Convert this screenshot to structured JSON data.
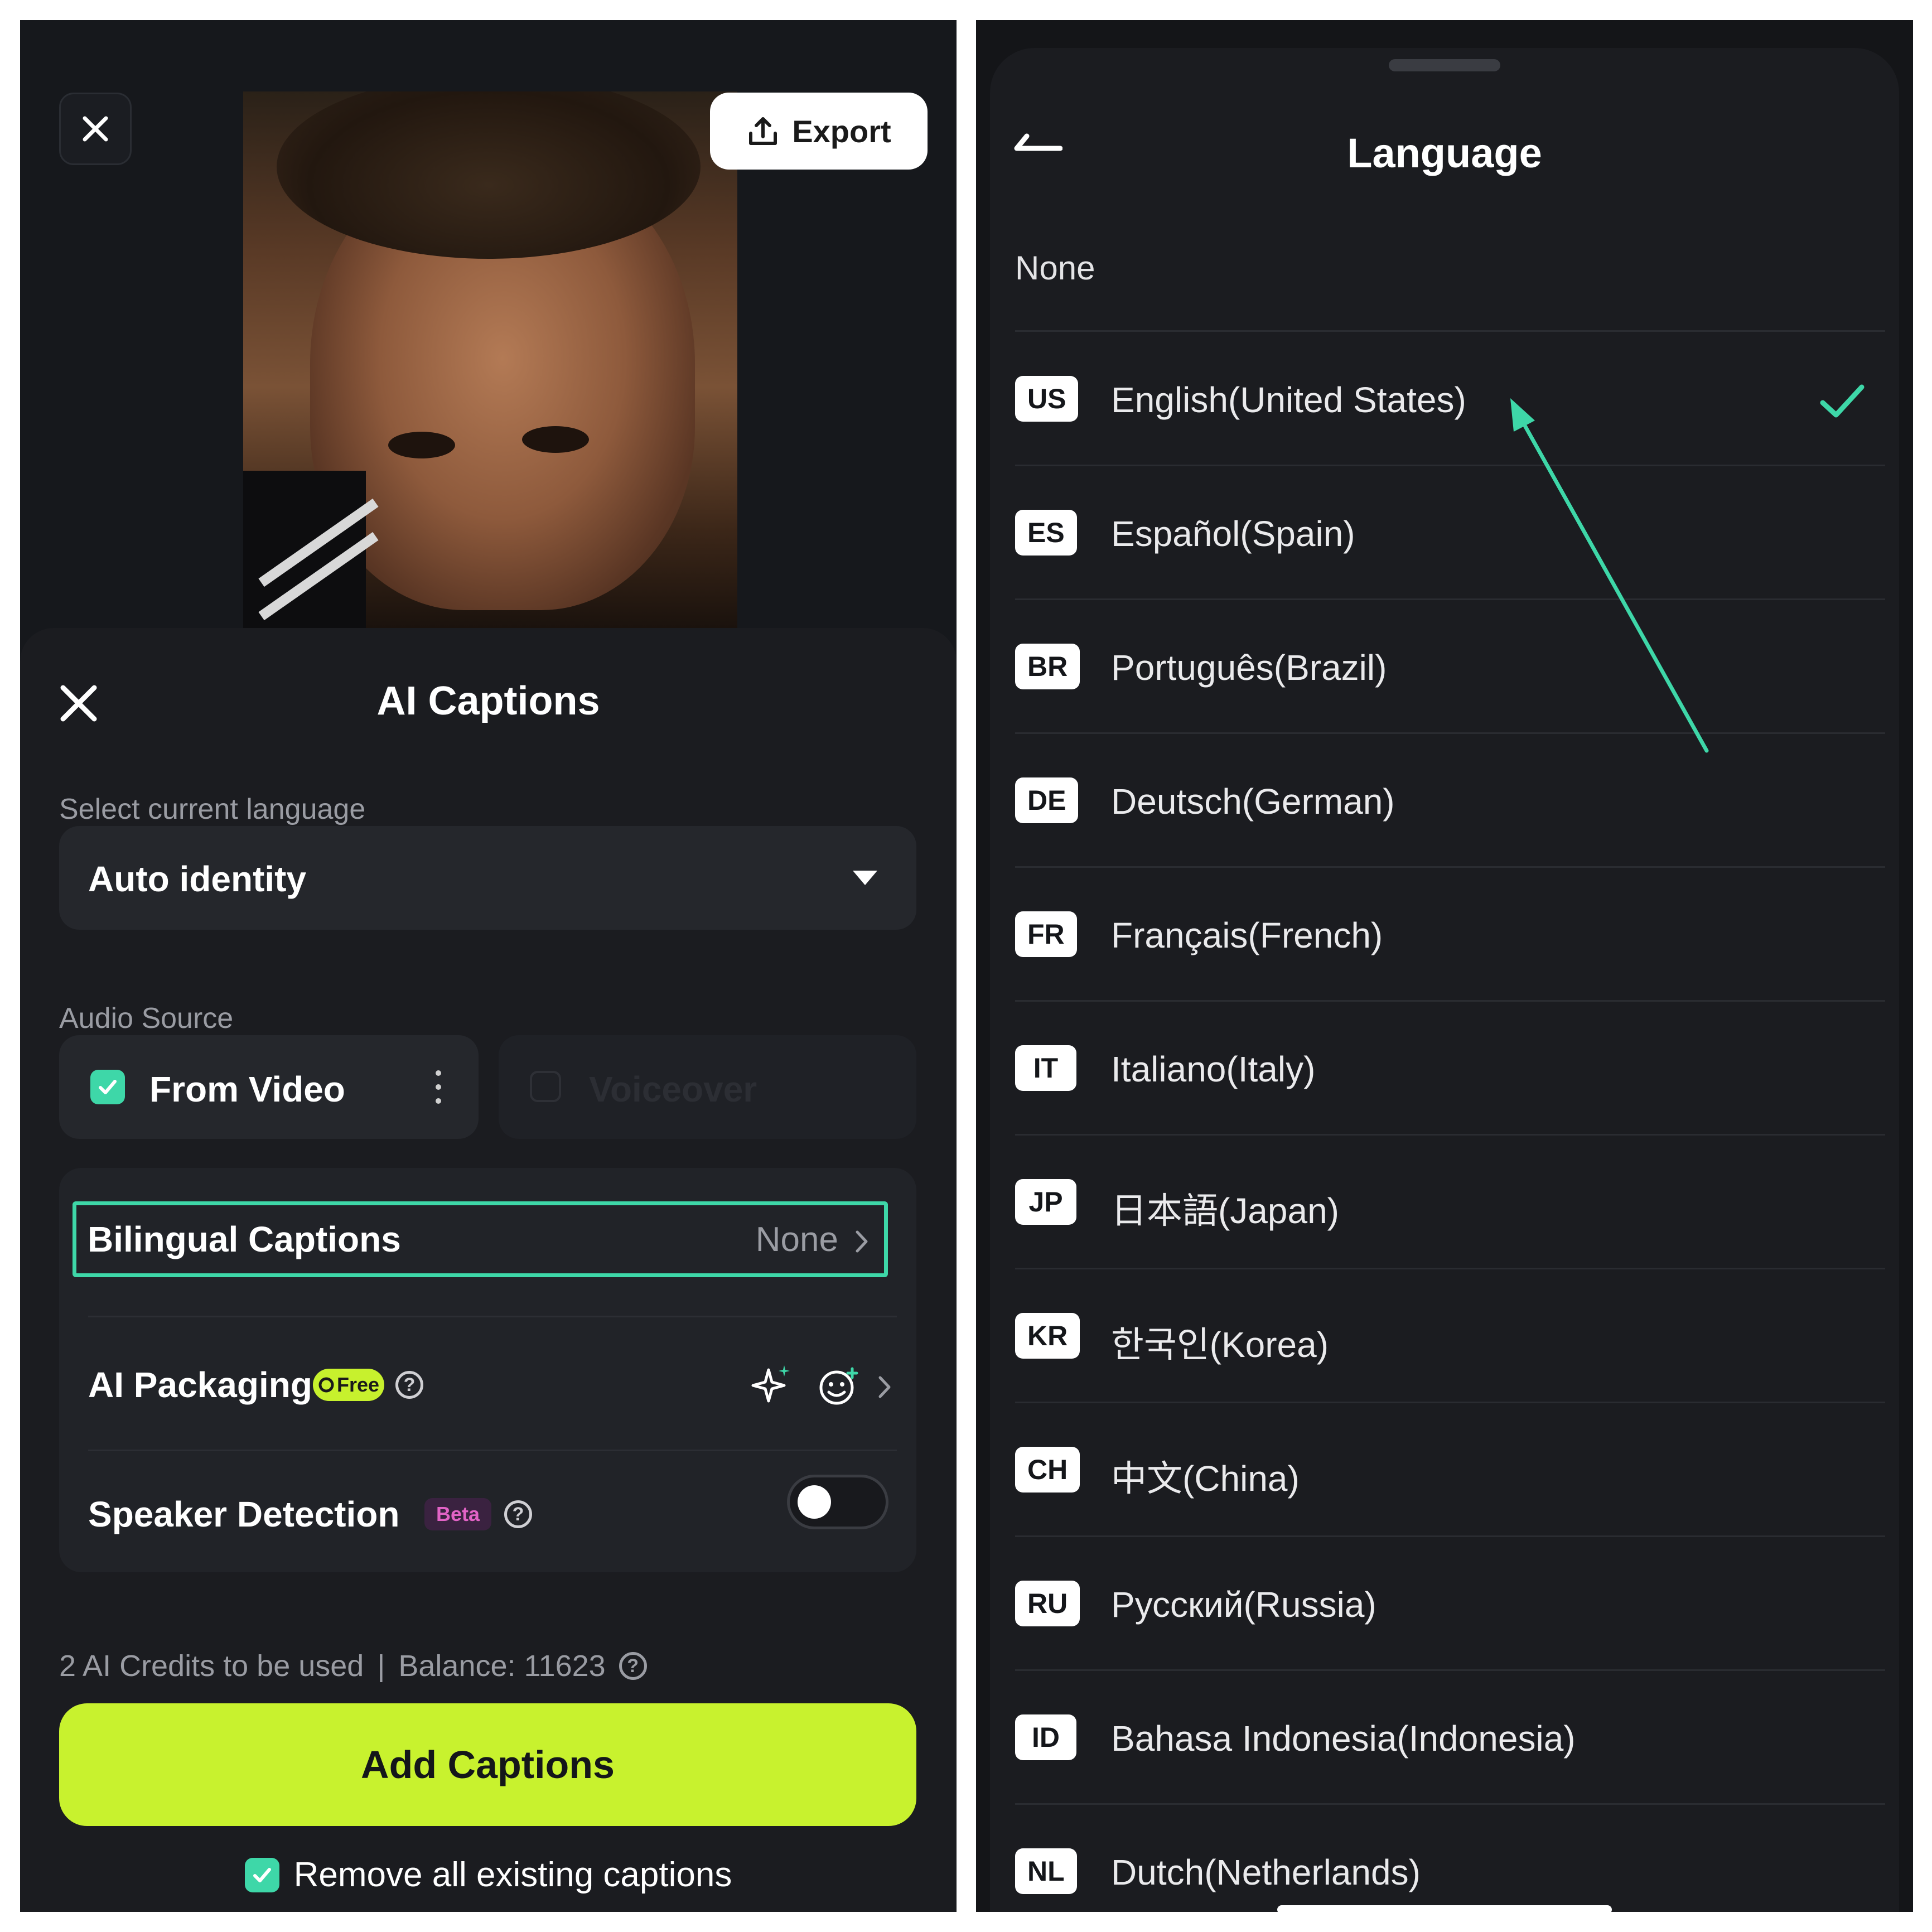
{
  "left": {
    "export_label": "Export",
    "title": "AI Captions",
    "select_language_label": "Select current language",
    "language_value": "Auto identity",
    "audio_source_label": "Audio Source",
    "from_video_label": "From Video",
    "voiceover_label": "Voiceover",
    "bilingual_label": "Bilingual Captions",
    "bilingual_value": "None",
    "packaging_label": "AI Packaging",
    "free_badge": "Free",
    "speaker_label": "Speaker Detection",
    "beta_badge": "Beta",
    "speaker_detection_on": false,
    "credits_text": "2 AI Credits to be used",
    "credits_separator": "|",
    "balance_text": "Balance: 11623",
    "add_button": "Add Captions",
    "remove_label": "Remove all existing captions",
    "remove_checked": true,
    "accent_color": "#3ed7a8",
    "cta_color": "#c8f22e"
  },
  "right": {
    "title": "Language",
    "none_label": "None",
    "languages": [
      {
        "code": "US",
        "name": "English(United States)",
        "selected": true
      },
      {
        "code": "ES",
        "name": "Español(Spain)"
      },
      {
        "code": "BR",
        "name": "Português(Brazil)"
      },
      {
        "code": "DE",
        "name": "Deutsch(German)"
      },
      {
        "code": "FR",
        "name": "Français(French)"
      },
      {
        "code": "IT",
        "name": "Italiano(Italy)"
      },
      {
        "code": "JP",
        "name": "日本語(Japan)"
      },
      {
        "code": "KR",
        "name": "한국인(Korea)"
      },
      {
        "code": "CH",
        "name": "中文(China)"
      },
      {
        "code": "RU",
        "name": "Русский(Russia)"
      },
      {
        "code": "ID",
        "name": "Bahasa Indonesia(Indonesia)"
      },
      {
        "code": "NL",
        "name": "Dutch(Netherlands)"
      }
    ]
  }
}
